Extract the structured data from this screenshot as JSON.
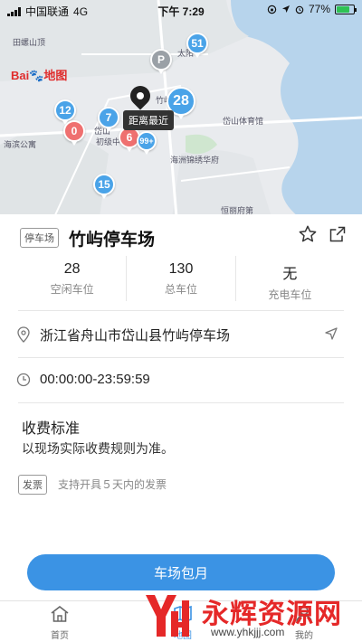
{
  "status_bar": {
    "carrier": "中国联通",
    "network": "4G",
    "time": "下午 7:29",
    "battery": "77%",
    "battery_level": 0.77
  },
  "map": {
    "logo_text": "地图",
    "logo_brand": "Bai",
    "places": [
      "田螺山顶",
      "海滨公寓",
      "岱山体育馆",
      "海洲锦绣华府",
      "恒丽府第",
      "初级中学",
      "岱山",
      "竹屿",
      "太阳"
    ],
    "clusters": [
      "51",
      "12",
      "7",
      "28",
      "0",
      "6",
      "99+",
      "15"
    ],
    "selected_label": "距离最近"
  },
  "panel": {
    "tag": "停车场",
    "name": "竹屿停车场",
    "stats": [
      {
        "value": "28",
        "label": "空闲车位"
      },
      {
        "value": "130",
        "label": "总车位"
      },
      {
        "value": "无",
        "label": "充电车位"
      }
    ],
    "address": "浙江省舟山市岱山县竹屿停车场",
    "hours": "00:00:00-23:59:59",
    "fee_title": "收费标准",
    "fee_desc": "以现场实际收费规则为准。",
    "invoice_tag": "发票",
    "invoice_note": "支持开具５天内的发票",
    "cta": "车场包月"
  },
  "tabbar": {
    "tabs": [
      {
        "label": "首页"
      },
      {
        "label": "地图"
      },
      {
        "label": "我的"
      }
    ]
  },
  "watermark": {
    "title": "永辉资源网",
    "url": "www.yhkjjj.com"
  },
  "colors": {
    "accent": "#3b93e4",
    "cluster_blue": "#4aa3e8",
    "cluster_red": "#ef7070",
    "watermark_red": "#e52828"
  }
}
